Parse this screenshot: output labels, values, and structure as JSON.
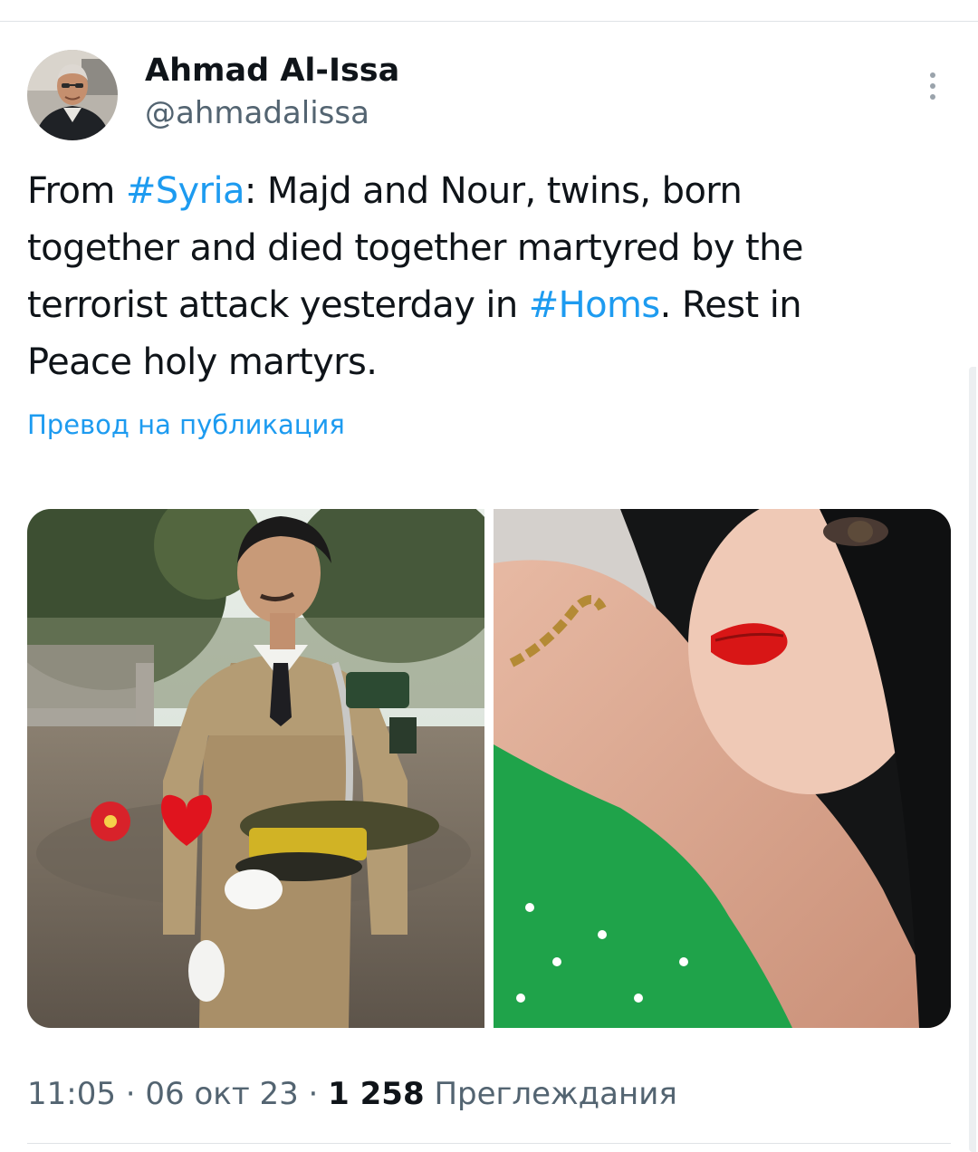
{
  "author": {
    "display_name": "Ahmad Al-Issa",
    "handle": "@ahmadalissa",
    "avatar_icon": "profile-photo"
  },
  "more_icon": "more-vertical-icon",
  "tweet": {
    "lines": [
      [
        {
          "text": "From ",
          "type": "text"
        },
        {
          "text": "#Syria",
          "type": "hashtag"
        },
        {
          "text": ": Majd and Nour, twins, born",
          "type": "text"
        }
      ],
      [
        {
          "text": "together and died together martyred by the",
          "type": "text"
        }
      ],
      [
        {
          "text": "terrorist attack yesterday in ",
          "type": "text"
        },
        {
          "text": "#Homs",
          "type": "hashtag"
        },
        {
          "text": ". Rest in",
          "type": "text"
        }
      ],
      [
        {
          "text": "Peace holy martyrs.",
          "type": "text"
        }
      ]
    ]
  },
  "translate_link": "Превод на публикация",
  "meta": {
    "time": "11:05",
    "separator": "·",
    "date": "06 окт 23",
    "views_count": "1 258",
    "views_label": "Преглеждания"
  },
  "colors": {
    "link": "#1d9bf0",
    "text": "#0f1419",
    "secondary": "#536471"
  }
}
